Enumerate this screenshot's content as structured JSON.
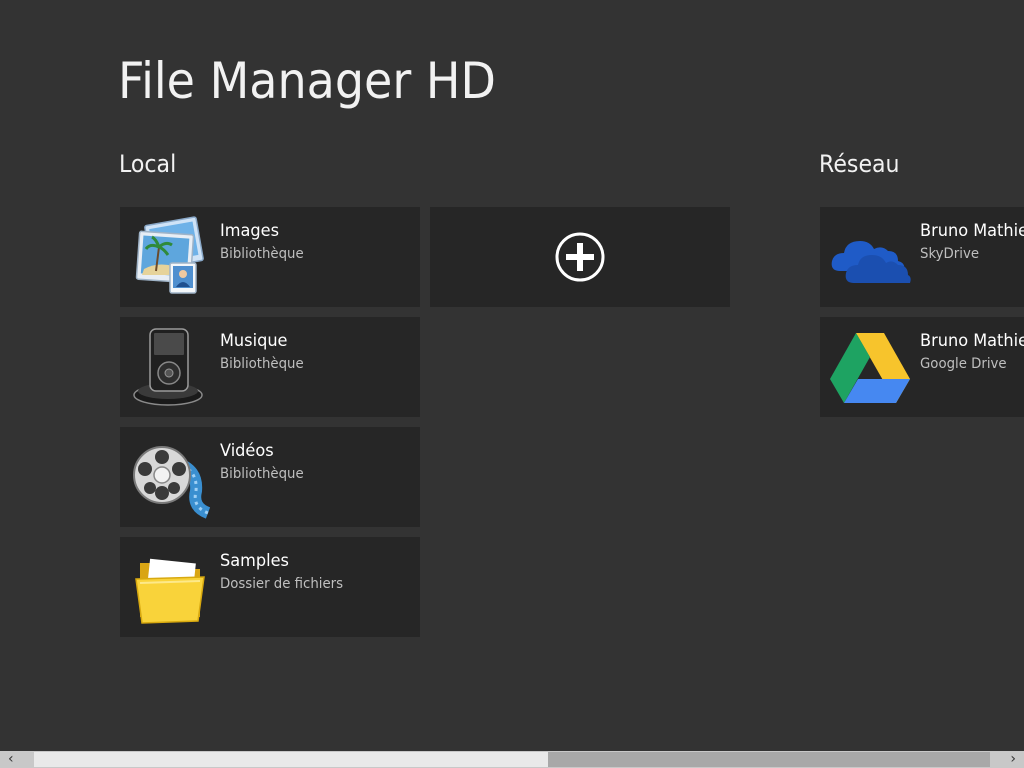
{
  "app": {
    "title": "File Manager HD"
  },
  "groups": {
    "local": {
      "header": "Local"
    },
    "network": {
      "header": "Réseau"
    }
  },
  "local_tiles": [
    {
      "title": "Images",
      "subtitle": "Bibliothèque",
      "icon": "pictures-library-icon"
    },
    {
      "title": "Musique",
      "subtitle": "Bibliothèque",
      "icon": "music-player-icon"
    },
    {
      "title": "Vidéos",
      "subtitle": "Bibliothèque",
      "icon": "film-reel-icon"
    },
    {
      "title": "Samples",
      "subtitle": "Dossier de fichiers",
      "icon": "folder-icon"
    }
  ],
  "add_tile": {
    "icon": "plus-circle-icon"
  },
  "network_tiles": [
    {
      "title": "Bruno Mathieu",
      "subtitle": "SkyDrive",
      "icon": "skydrive-cloud-icon"
    },
    {
      "title": "Bruno Mathieu",
      "subtitle": "Google Drive",
      "icon": "google-drive-icon"
    }
  ],
  "scrollbar": {
    "left_arrow": "‹",
    "right_arrow": "›"
  }
}
